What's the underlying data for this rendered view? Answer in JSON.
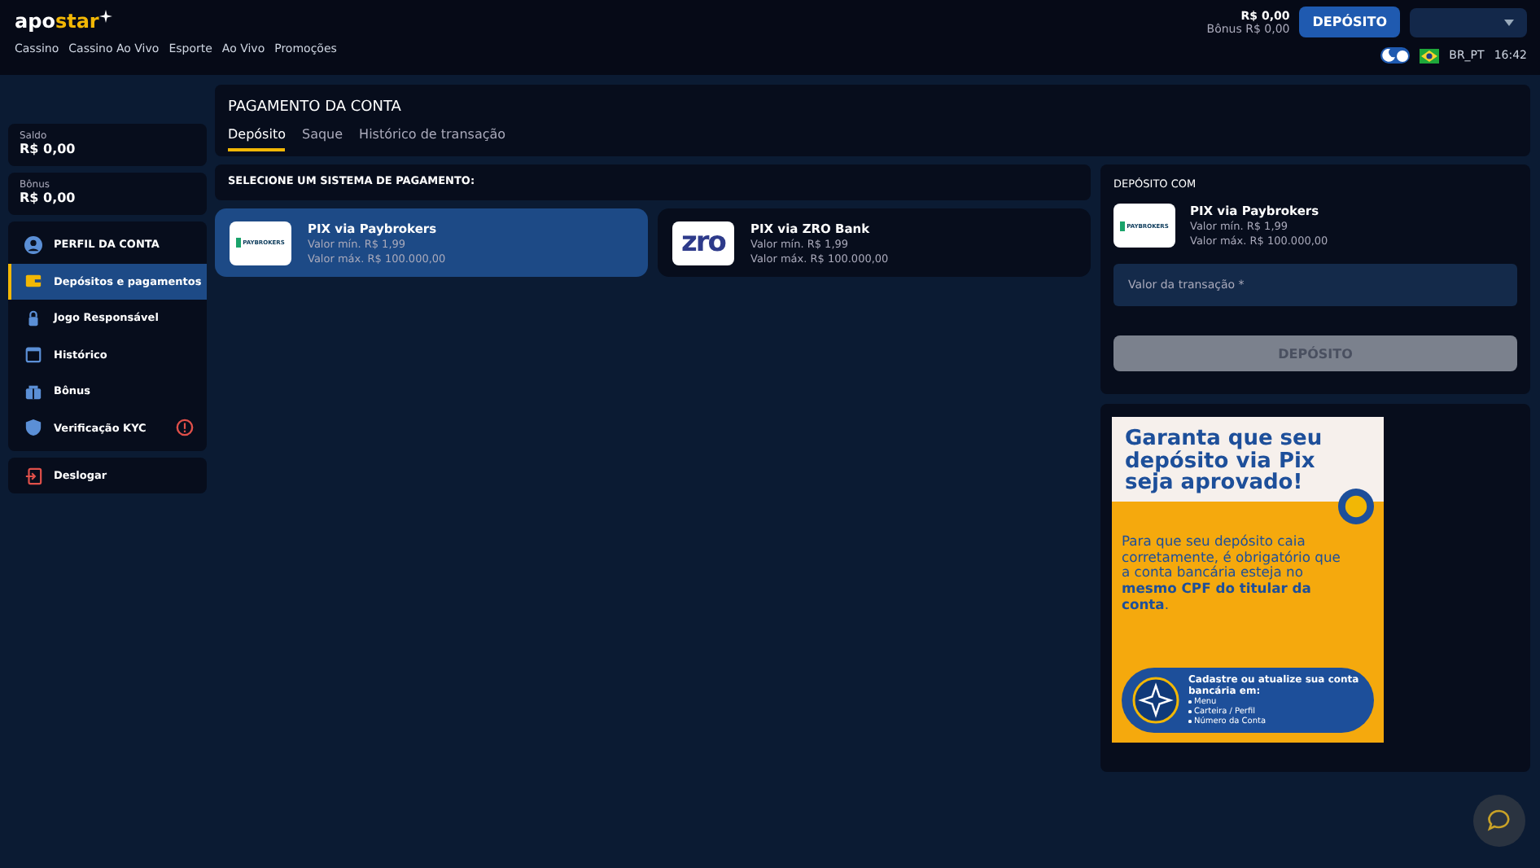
{
  "header": {
    "logo": {
      "part_1": "apo",
      "part_2": "star"
    },
    "nav": [
      "Cassino",
      "Cassino Ao Vivo",
      "Esporte",
      "Ao Vivo",
      "Promoções"
    ],
    "balance": "R$ 0,00",
    "bonus_balance": "Bônus R$ 0,00",
    "deposit_button": "DEPÓSITO",
    "theme_toggle": {
      "on": true
    },
    "locale": "BR_PT",
    "time": "16:42"
  },
  "sidebar": {
    "balances": [
      {
        "label": "Saldo",
        "value": "R$ 0,00"
      },
      {
        "label": "Bônus",
        "value": "R$ 0,00"
      }
    ],
    "items": [
      {
        "kind": "profile",
        "label": "PERFIL DA CONTA",
        "selected": false,
        "alert": false
      },
      {
        "kind": "wallet",
        "label": "Depósitos e pagamentos",
        "selected": true,
        "alert": false
      },
      {
        "kind": "lock",
        "label": "Jogo Responsável",
        "selected": false,
        "alert": false
      },
      {
        "kind": "calendar",
        "label": "Histórico",
        "selected": false,
        "alert": false
      },
      {
        "kind": "gift",
        "label": "Bônus",
        "selected": false,
        "alert": false
      },
      {
        "kind": "shield",
        "label": "Verificação KYC",
        "selected": false,
        "alert": true
      }
    ],
    "logout": "Deslogar"
  },
  "page": {
    "title": "PAGAMENTO DA CONTA",
    "tabs": [
      {
        "label": "Depósito",
        "selected": true
      },
      {
        "label": "Saque",
        "selected": false
      },
      {
        "label": "Histórico de transação",
        "selected": false
      }
    ]
  },
  "payment": {
    "heading": "SELECIONE UM SISTEMA DE PAGAMENTO:",
    "methods": [
      {
        "kind": "paybrokers",
        "logo_text": "PAYBROKERS",
        "name": "PIX via Paybrokers",
        "min": "Valor mín. R$ 1,99",
        "max": "Valor máx. R$ 100.000,00",
        "selected": true
      },
      {
        "kind": "zro",
        "logo_text": "zro",
        "name": "PIX via ZRO Bank",
        "min": "Valor mín. R$ 1,99",
        "max": "Valor máx. R$ 100.000,00",
        "selected": false
      }
    ]
  },
  "deposit": {
    "heading": "DEPÓSITO COM",
    "method": {
      "logo_text": "PAYBROKERS",
      "name": "PIX via Paybrokers",
      "min": "Valor mín. R$ 1,99",
      "max": "Valor máx. R$ 100.000,00"
    },
    "amount_placeholder": "Valor da transação *",
    "button": "DEPÓSITO",
    "button_disabled": true
  },
  "banner": {
    "headline": "Garanta que seu depósito via Pix seja aprovado!",
    "body": "Para que seu depósito caia corretamente, é obrigatório que a conta bancária esteja no **mesmo CPF do titular da conta**.",
    "callout": "Cadastre ou atualize sua conta bancária em:",
    "steps": [
      "Menu",
      "Carteira / Perfil",
      "Número da Conta"
    ]
  }
}
